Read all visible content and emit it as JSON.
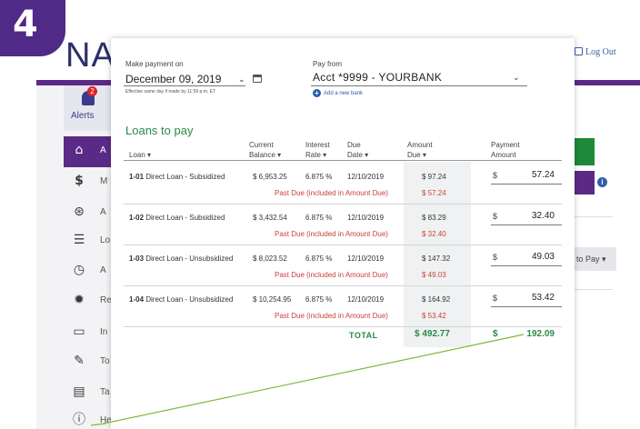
{
  "step_number": "4",
  "background": {
    "app_title": "NA",
    "logout": "Log Out",
    "alerts_label": "Alerts",
    "alerts_count": "2",
    "nav_letters": [
      "A",
      "M",
      "A",
      "Lo",
      "A",
      "Re",
      "In",
      "To",
      "Ta",
      "He"
    ],
    "right_button": "to Pay"
  },
  "modal": {
    "payment_on_label": "Make payment on",
    "payment_date": "December 09, 2019",
    "effective_note": "Effective same day if made by 11:59 p.m. ET",
    "pay_from_label": "Pay from",
    "pay_from_account": "Acct *9999 - YOURBANK",
    "add_bank": "Add a new bank",
    "loans_heading": "Loans to pay",
    "columns": {
      "loan": "Loan",
      "current_balance_1": "Current",
      "current_balance_2": "Balance",
      "interest_rate_1": "Interest",
      "interest_rate_2": "Rate",
      "due_date_1": "Due",
      "due_date_2": "Date",
      "amount_due_1": "Amount",
      "amount_due_2": "Due",
      "payment_amount_1": "Payment",
      "payment_amount_2": "Amount"
    },
    "sort_icon": "sort-down-icon",
    "past_due_text": "Past Due (included in Amount Due)",
    "loans": [
      {
        "code": "1-01",
        "name": "Direct Loan - Subsidized",
        "balance": "$  6,953.25",
        "rate": "6.875 %",
        "due_date": "12/10/2019",
        "amount_due": "$  97.24",
        "past_due": "$  57.24",
        "payment": "57.24"
      },
      {
        "code": "1-02",
        "name": "Direct Loan - Subsidized",
        "balance": "$  3,432.54",
        "rate": "6.875 %",
        "due_date": "12/10/2019",
        "amount_due": "$  83.29",
        "past_due": "$  32.40",
        "payment": "32.40"
      },
      {
        "code": "1-03",
        "name": "Direct Loan - Unsubsidized",
        "balance": "$  8,023.52",
        "rate": "6.875 %",
        "due_date": "12/10/2019",
        "amount_due": "$ 147.32",
        "past_due": "$  49.03",
        "payment": "49.03"
      },
      {
        "code": "1-04",
        "name": "Direct Loan - Unsubsidized",
        "balance": "$ 10,254.95",
        "rate": "6.875 %",
        "due_date": "12/10/2019",
        "amount_due": "$ 164.92",
        "past_due": "$  53.42",
        "payment": "53.42"
      }
    ],
    "dollar_sign": "$",
    "total_label": "TOTAL",
    "total_amount_due": "$  492.77",
    "total_payment": "192.09"
  },
  "colors": {
    "accent_purple": "#5b2a86",
    "heading_green": "#2a8a45",
    "past_due_red": "#c8423a",
    "link_blue": "#2a5da8",
    "annotation_line": "#7fba3a"
  }
}
